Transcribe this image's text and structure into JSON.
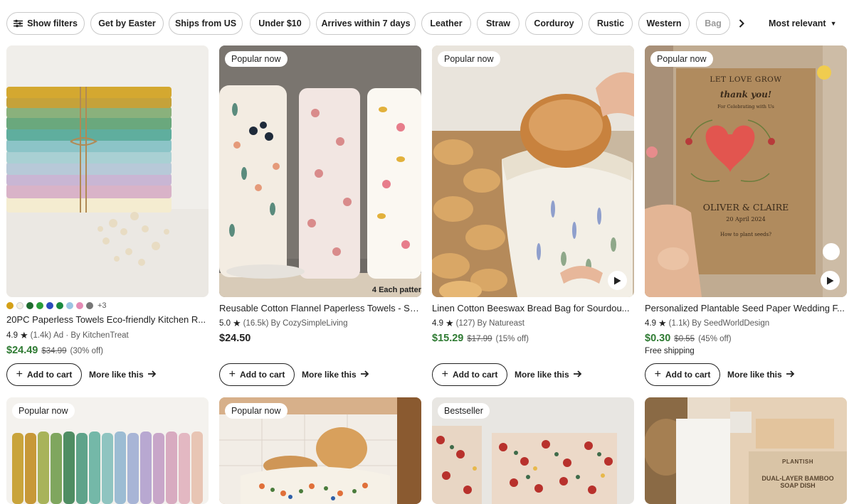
{
  "filters": {
    "show_filters": "Show filters",
    "chips": [
      "Get by Easter",
      "Ships from US",
      "Under $10",
      "Arrives within 7 days",
      "Leather",
      "Straw",
      "Corduroy",
      "Rustic",
      "Western",
      "Bag"
    ],
    "sort": "Most relevant"
  },
  "products": [
    {
      "title": "20PC Paperless Towels Eco-friendly Kitchen R...",
      "rating": "4.9",
      "reviews": "(1.4k)",
      "ad": "Ad · By KitchenTreat",
      "price": "$24.49",
      "was": "$34.99",
      "off": "(30% off)",
      "swatch_colors": [
        "#d4a017",
        "#f2efe4",
        "#1e6b2e",
        "#2a9d3a",
        "#2b4bbd",
        "#1a8a3e",
        "#9bc4e2",
        "#e58bb5",
        "#777777"
      ],
      "swatch_more": "+3"
    },
    {
      "badge": "Popular now",
      "overlay": "4 Each patter",
      "title": "Reusable Cotton Flannel Paperless Towels - Se...",
      "rating": "5.0",
      "reviews": "(16.5k)",
      "seller": "By CozySimpleLiving",
      "price": "$24.50"
    },
    {
      "badge": "Popular now",
      "title": "Linen Cotton Beeswax Bread Bag for Sourdou...",
      "rating": "4.9",
      "reviews": "(127)",
      "seller": "By Natureast",
      "price": "$15.29",
      "was": "$17.99",
      "off": "(15% off)"
    },
    {
      "badge": "Popular now",
      "title": "Personalized Plantable Seed Paper Wedding F...",
      "rating": "4.9",
      "reviews": "(1.1k)",
      "seller": "By SeedWorldDesign",
      "price": "$0.30",
      "was": "$0.55",
      "off": "(45% off)",
      "shipping": "Free shipping"
    }
  ],
  "seed_card": {
    "line1": "LET LOVE GROW",
    "line2": "thank you!",
    "line3": "For Celebrating with Us",
    "names": "OLIVER & CLAIRE",
    "date": "20 April 2024",
    "how": "How to plant seeds?"
  },
  "row2": [
    {
      "badge": "Popular now"
    },
    {
      "badge": "Popular now"
    },
    {
      "badge": "Bestseller"
    },
    {
      "brand": "PLANTISH",
      "product": "DUAL-LAYER BAMBOO",
      "product2": "SOAP DISH"
    }
  ],
  "add_to_cart": "Add to cart",
  "more_like_this": "More like this"
}
